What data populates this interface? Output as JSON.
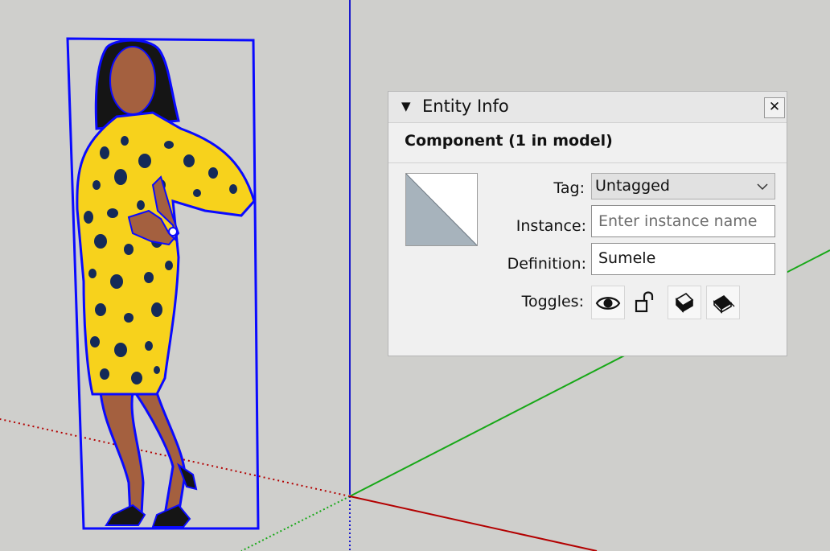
{
  "panel": {
    "title": "Entity Info",
    "collapse_glyph": "▼",
    "close_glyph": "✕",
    "entity_type": "Component (1 in model)",
    "tag": {
      "label": "Tag:",
      "value": "Untagged"
    },
    "instance": {
      "label": "Instance:",
      "value": "",
      "placeholder": "Enter instance name"
    },
    "definition": {
      "label": "Definition:",
      "value": "Sumele"
    },
    "toggles": {
      "label": "Toggles:",
      "items": [
        {
          "name": "visibility",
          "icon": "eye-icon"
        },
        {
          "name": "lock",
          "icon": "unlocked-padlock-icon"
        },
        {
          "name": "receive-shadows",
          "icon": "receive-shadows-icon"
        },
        {
          "name": "cast-shadows",
          "icon": "cast-shadows-icon"
        }
      ]
    }
  },
  "scene": {
    "axes": {
      "blue": "#1a1acc",
      "green": "#17a817",
      "red": "#b30000"
    },
    "selection_color": "#0a0aff",
    "figure": {
      "dress_color": "#f7d21c",
      "spot_color": "#142a58",
      "skin_color": "#a4603f"
    }
  },
  "colors": {
    "viewport_background": "#cfcfcc",
    "panel_background": "#f0f0f0"
  }
}
